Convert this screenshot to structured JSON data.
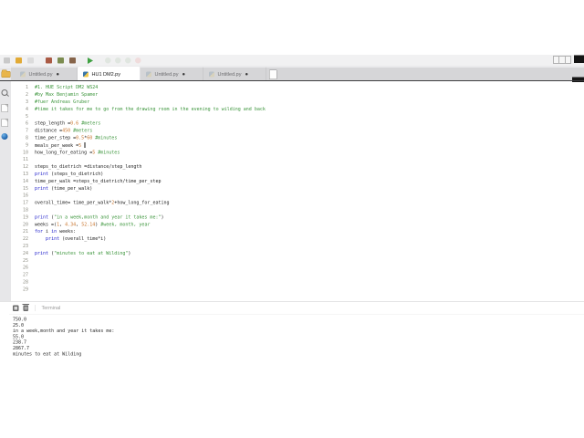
{
  "colors": {
    "comment": "#3a943a",
    "keyword": "#2323cc",
    "number": "#c8742c",
    "string": "#3a943a",
    "plain": "#1c1c1c"
  },
  "toolbar": {
    "groups": [
      [
        {
          "name": "new-file-icon",
          "color": "#c9c9c9",
          "shape": "square"
        },
        {
          "name": "open-file-icon",
          "color": "#e2aa35",
          "shape": "square"
        },
        {
          "name": "save-file-icon",
          "color": "#dcdcdc",
          "shape": "square"
        }
      ],
      [
        {
          "name": "tool-icon-1",
          "color": "#aa5a44",
          "shape": "square"
        },
        {
          "name": "tool-icon-2",
          "color": "#7c8c50",
          "shape": "square"
        },
        {
          "name": "tool-icon-3",
          "color": "#86644a",
          "shape": "square"
        }
      ],
      [
        {
          "name": "run-icon",
          "color": "#3fa142",
          "shape": "play"
        }
      ],
      [
        {
          "name": "step-icon-1",
          "color": "#e0e6e0",
          "shape": "circle"
        },
        {
          "name": "step-icon-2",
          "color": "#e0e6e0",
          "shape": "circle"
        },
        {
          "name": "step-icon-3",
          "color": "#e0e6e0",
          "shape": "circle"
        },
        {
          "name": "stop-icon",
          "color": "#f0dcdc",
          "shape": "circle"
        }
      ]
    ]
  },
  "tabbar": {
    "tabs": [
      {
        "label": "Untitled.py",
        "modified": true,
        "active": false
      },
      {
        "label": "HU1 DM2.py",
        "modified": false,
        "active": true
      },
      {
        "label": "Untitled.py",
        "modified": true,
        "active": false
      },
      {
        "label": "Untitled.py",
        "modified": true,
        "active": false
      }
    ]
  },
  "editor": {
    "cursor_line": 9,
    "lines": [
      {
        "n": 1,
        "segs": [
          [
            "c",
            "#1. HUE Script DM2 WS24"
          ]
        ]
      },
      {
        "n": 2,
        "segs": [
          [
            "c",
            "#by Max Benjamin Spamer"
          ]
        ]
      },
      {
        "n": 3,
        "segs": [
          [
            "c",
            "#fuer Andreas Gruber"
          ]
        ]
      },
      {
        "n": 4,
        "segs": [
          [
            "c",
            "#time it takes for me to go from the drawing room in the evening to wilding and back"
          ]
        ]
      },
      {
        "n": 5,
        "segs": []
      },
      {
        "n": 6,
        "segs": [
          [
            "t",
            "step_length ="
          ],
          [
            "n",
            "0.6"
          ],
          [
            "t",
            " "
          ],
          [
            "c",
            "#meters"
          ]
        ]
      },
      {
        "n": 7,
        "segs": [
          [
            "t",
            "distance ="
          ],
          [
            "n",
            "450"
          ],
          [
            "t",
            " "
          ],
          [
            "c",
            "#meters"
          ]
        ]
      },
      {
        "n": 8,
        "segs": [
          [
            "t",
            "time_per_step ="
          ],
          [
            "n",
            "0.5"
          ],
          [
            "t",
            "*"
          ],
          [
            "n",
            "60"
          ],
          [
            "t",
            " "
          ],
          [
            "c",
            "#minutes"
          ]
        ]
      },
      {
        "n": 9,
        "segs": [
          [
            "t",
            "meals_per_week ="
          ],
          [
            "n",
            "5"
          ],
          [
            "t",
            " "
          ]
        ]
      },
      {
        "n": 10,
        "segs": [
          [
            "t",
            "how_long_for_eating ="
          ],
          [
            "n",
            "5"
          ],
          [
            "t",
            " "
          ],
          [
            "c",
            "#minutes"
          ]
        ]
      },
      {
        "n": 11,
        "segs": []
      },
      {
        "n": 12,
        "segs": [
          [
            "t",
            "steps_to_dietrich =distance/step_length"
          ]
        ]
      },
      {
        "n": 13,
        "segs": [
          [
            "k",
            "print"
          ],
          [
            "t",
            " (steps_to_dietrich)"
          ]
        ]
      },
      {
        "n": 14,
        "segs": [
          [
            "t",
            "time_per_walk =steps_to_dietrich/time_per_step"
          ]
        ]
      },
      {
        "n": 15,
        "segs": [
          [
            "k",
            "print"
          ],
          [
            "t",
            " (time_per_walk)"
          ]
        ]
      },
      {
        "n": 16,
        "segs": []
      },
      {
        "n": 17,
        "segs": [
          [
            "t",
            "overall_time= time_per_walk*"
          ],
          [
            "n",
            "2"
          ],
          [
            "t",
            "+how_long_for_eating"
          ]
        ]
      },
      {
        "n": 18,
        "segs": []
      },
      {
        "n": 19,
        "segs": [
          [
            "k",
            "print"
          ],
          [
            "t",
            " ("
          ],
          [
            "s",
            "\"in a week,month and year it takes me:\""
          ],
          [
            "t",
            ")"
          ]
        ]
      },
      {
        "n": 20,
        "segs": [
          [
            "t",
            "weeks =("
          ],
          [
            "n",
            "1"
          ],
          [
            "t",
            ", "
          ],
          [
            "n",
            "4.34"
          ],
          [
            "t",
            ", "
          ],
          [
            "n",
            "52.14"
          ],
          [
            "t",
            ") "
          ],
          [
            "c",
            "#week, month, year"
          ]
        ]
      },
      {
        "n": 21,
        "segs": [
          [
            "k",
            "for"
          ],
          [
            "t",
            " i "
          ],
          [
            "k",
            "in"
          ],
          [
            "t",
            " weeks:"
          ]
        ]
      },
      {
        "n": 22,
        "segs": [
          [
            "t",
            "    "
          ],
          [
            "k",
            "print"
          ],
          [
            "t",
            " (overall_time*i)"
          ]
        ]
      },
      {
        "n": 23,
        "segs": []
      },
      {
        "n": 24,
        "segs": [
          [
            "k",
            "print"
          ],
          [
            "t",
            " ("
          ],
          [
            "s",
            "\"minutes to eat at Wilding\""
          ],
          [
            "t",
            ")"
          ]
        ]
      },
      {
        "n": 25,
        "segs": []
      },
      {
        "n": 26,
        "segs": []
      },
      {
        "n": 27,
        "segs": []
      },
      {
        "n": 28,
        "segs": []
      },
      {
        "n": 29,
        "segs": []
      }
    ]
  },
  "terminal": {
    "title": "Terminal",
    "lines": [
      "750.0",
      "25.0",
      "in a week,month and year it takes me:",
      "55.0",
      "238.7",
      "2867.7",
      "minutes to eat at Wilding"
    ]
  }
}
